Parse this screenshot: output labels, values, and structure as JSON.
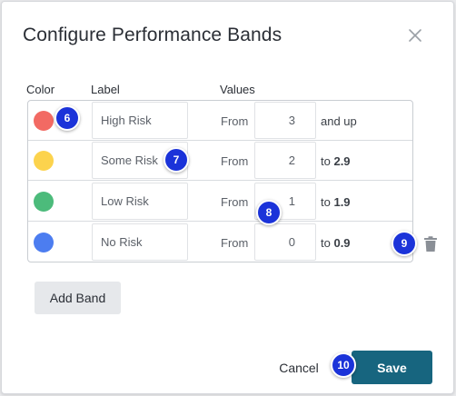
{
  "dialog": {
    "title": "Configure Performance Bands",
    "close_icon": "close-icon"
  },
  "columns": {
    "color": "Color",
    "label": "Label",
    "values": "Values"
  },
  "bands": [
    {
      "color": "#f26a63",
      "label": "High Risk",
      "from_label": "From",
      "from_value": "3",
      "upper_prefix": "and up",
      "upper_value": ""
    },
    {
      "color": "#fcd34d",
      "label": "Some Risk",
      "from_label": "From",
      "from_value": "2",
      "upper_prefix": "to",
      "upper_value": "2.9"
    },
    {
      "color": "#4cbb7b",
      "label": "Low Risk",
      "from_label": "From",
      "from_value": "1",
      "upper_prefix": "to",
      "upper_value": "1.9"
    },
    {
      "color": "#4c7df0",
      "label": "No Risk",
      "from_label": "From",
      "from_value": "0",
      "upper_prefix": "to",
      "upper_value": "0.9"
    }
  ],
  "actions": {
    "add_band": "Add Band",
    "cancel": "Cancel",
    "save": "Save",
    "delete_icon": "trash-icon"
  },
  "badges": [
    "6",
    "7",
    "8",
    "9",
    "10"
  ],
  "colors": {
    "primary": "#17657f",
    "badge": "#1b33d9"
  }
}
